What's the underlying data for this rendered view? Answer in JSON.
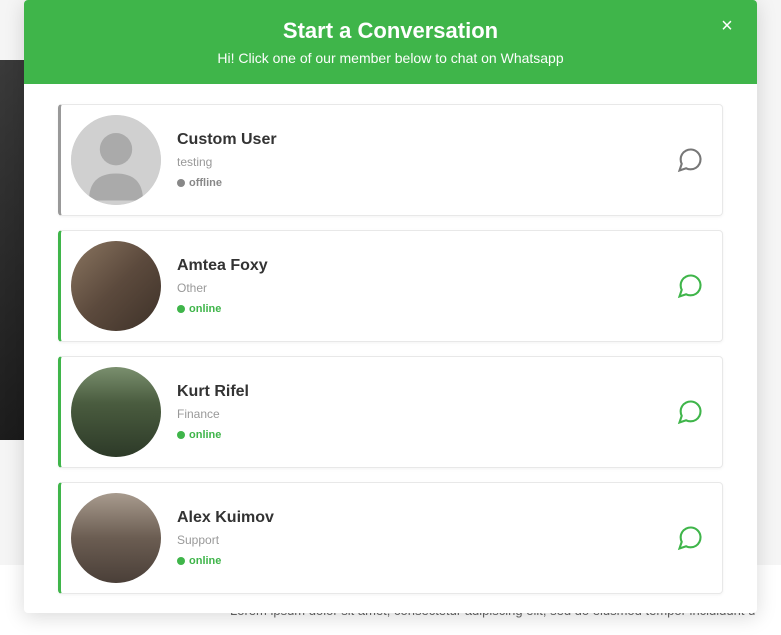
{
  "modal": {
    "title": "Start a Conversation",
    "subtitle": "Hi! Click one of our member below to chat on Whatsapp",
    "close_label": "×"
  },
  "members": [
    {
      "name": "Custom User",
      "role": "testing",
      "status": "offline",
      "status_label": "offline",
      "avatar_type": "placeholder"
    },
    {
      "name": "Amtea Foxy",
      "role": "Other",
      "status": "online",
      "status_label": "online",
      "avatar_type": "photo-1"
    },
    {
      "name": "Kurt Rifel",
      "role": "Finance",
      "status": "online",
      "status_label": "online",
      "avatar_type": "photo-2"
    },
    {
      "name": "Alex Kuimov",
      "role": "Support",
      "status": "online",
      "status_label": "online",
      "avatar_type": "photo-3"
    }
  ],
  "background": {
    "lorem_text": "Lorem ipsum dolor sit amet, consectetur adipiscing elit, sed do eiusmod tempor incididunt u"
  },
  "colors": {
    "brand_green": "#3fb54a",
    "offline_gray": "#888"
  }
}
